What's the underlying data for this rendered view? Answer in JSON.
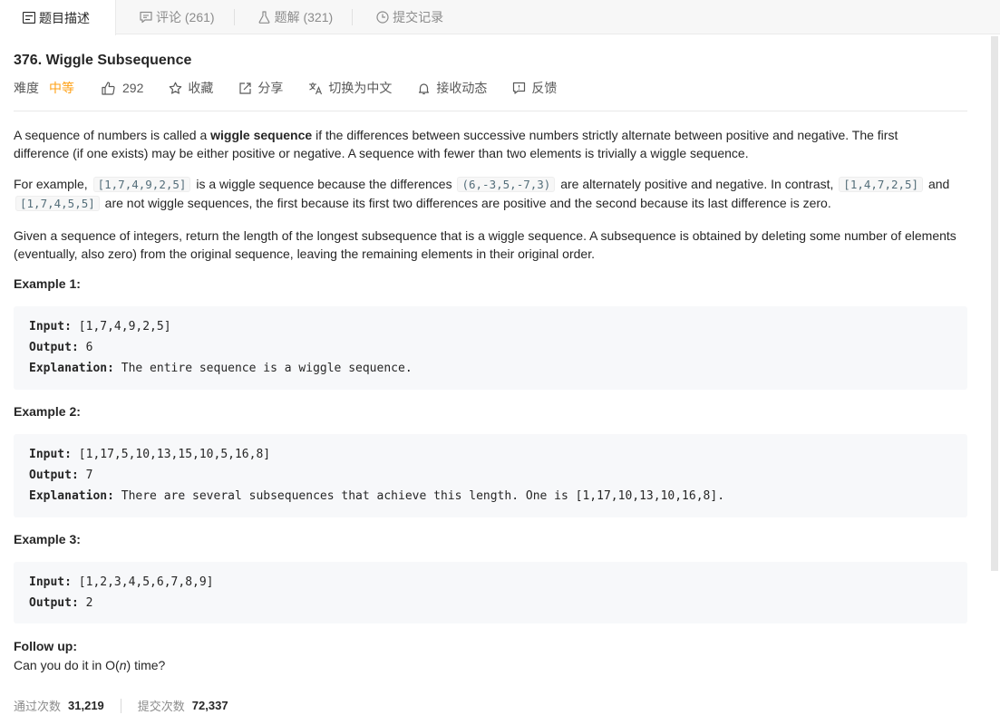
{
  "tabs": [
    {
      "label": "题目描述",
      "icon": "description-icon"
    },
    {
      "label": "评论 (261)",
      "icon": "comment-icon"
    },
    {
      "label": "题解 (321)",
      "icon": "flask-icon"
    },
    {
      "label": "提交记录",
      "icon": "clock-icon"
    }
  ],
  "problem": {
    "title": "376. Wiggle Subsequence",
    "difficulty_label": "难度",
    "difficulty": "中等",
    "likes": "292",
    "favorite": "收藏",
    "share": "分享",
    "switch_lang": "切换为中文",
    "subscribe": "接收动态",
    "feedback": "反馈"
  },
  "description": {
    "p1_a": "A sequence of numbers is called a ",
    "p1_b": "wiggle sequence",
    "p1_c": " if the differences between successive numbers strictly alternate between positive and negative. The first difference (if one exists) may be either positive or negative. A sequence with fewer than two elements is trivially a wiggle sequence.",
    "p2_a": "For example, ",
    "p2_code1": "[1,7,4,9,2,5]",
    "p2_b": " is a wiggle sequence because the differences ",
    "p2_code2": "(6,-3,5,-7,3)",
    "p2_c": " are alternately positive and negative. In contrast, ",
    "p2_code3": "[1,4,7,2,5]",
    "p2_d": " and ",
    "p2_code4": "[1,7,4,5,5]",
    "p2_e": " are not wiggle sequences, the first because its first two differences are positive and the second because its last difference is zero.",
    "p3": "Given a sequence of integers, return the length of the longest subsequence that is a wiggle sequence. A subsequence is obtained by deleting some number of elements (eventually, also zero) from the original sequence, leaving the remaining elements in their original order."
  },
  "examples": [
    {
      "heading": "Example 1:",
      "input_label": "Input:",
      "input": " [1,7,4,9,2,5]",
      "output_label": "Output:",
      "output": " 6",
      "explanation_label": "Explanation:",
      "explanation": " The entire sequence is a wiggle sequence."
    },
    {
      "heading": "Example 2:",
      "input_label": "Input:",
      "input": " [1,17,5,10,13,15,10,5,16,8]",
      "output_label": "Output:",
      "output": " 7",
      "explanation_label": "Explanation:",
      "explanation": " There are several subsequences that achieve this length. One is [1,17,10,13,10,16,8]."
    },
    {
      "heading": "Example 3:",
      "input_label": "Input:",
      "input": " [1,2,3,4,5,6,7,8,9]",
      "output_label": "Output:",
      "output": " 2"
    }
  ],
  "follow_up": {
    "heading": "Follow up:",
    "text_a": "Can you do it in O(",
    "text_n": "n",
    "text_b": ") time?"
  },
  "stats": {
    "accepted_label": "通过次数",
    "accepted": "31,219",
    "submissions_label": "提交次数",
    "submissions": "72,337"
  },
  "colors": {
    "accent": "#ffa116"
  }
}
